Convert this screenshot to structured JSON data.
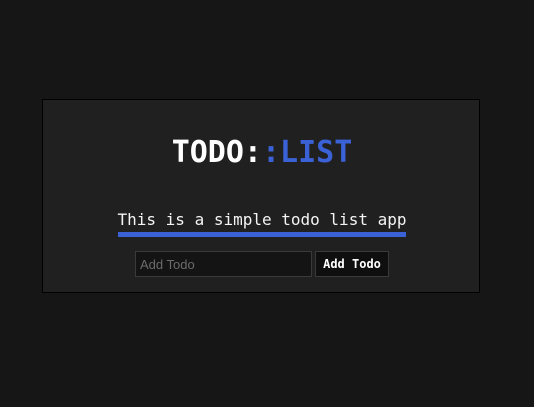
{
  "app": {
    "title_part1": "TODO:",
    "title_part2": ":LIST",
    "subtitle": "This is a simple todo list app"
  },
  "form": {
    "input_value": "",
    "input_placeholder": "Add Todo",
    "button_label": "Add Todo"
  },
  "colors": {
    "background": "#161616",
    "card": "#202020",
    "accent": "#3a62d6",
    "text": "#ffffff"
  }
}
